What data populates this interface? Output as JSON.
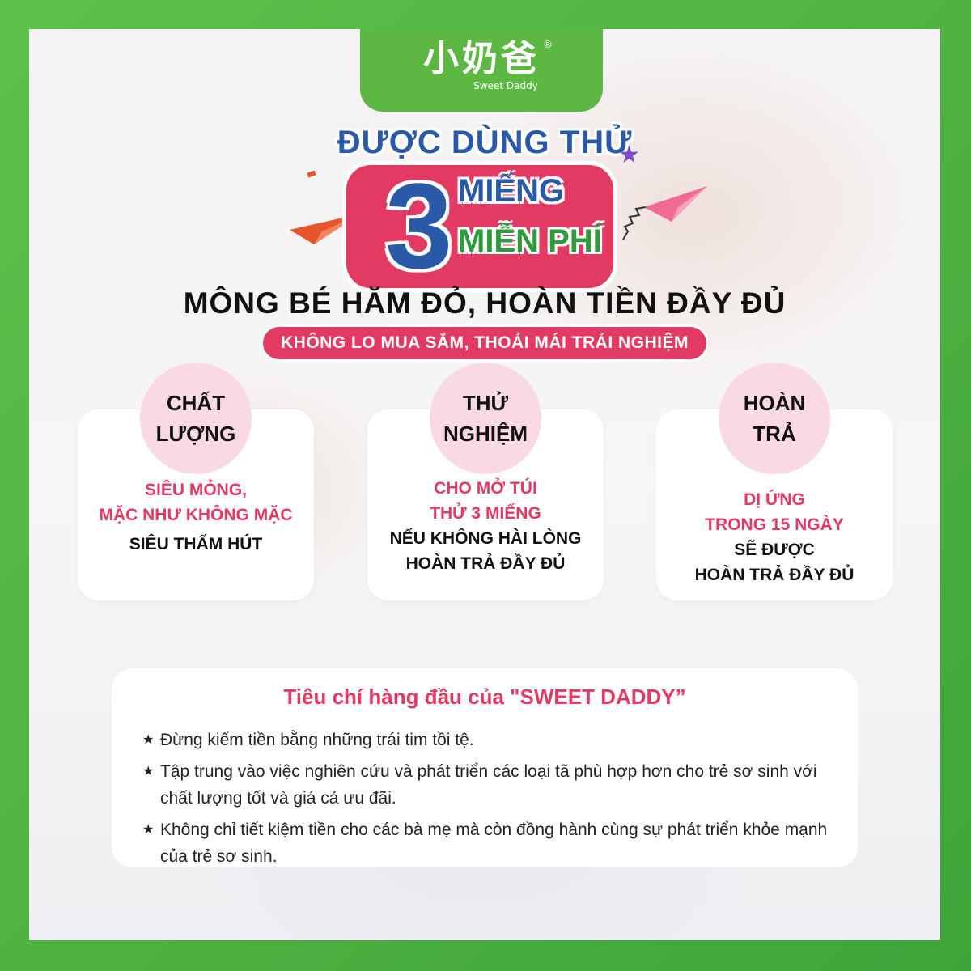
{
  "logo": {
    "main": "小奶爸",
    "sub": "Sweet Daddy",
    "reg": "®"
  },
  "headline": {
    "top": "ĐƯỢC DÙNG THỬ",
    "number": "3",
    "line1": "MIẾNG",
    "line2": "MIỄN PHÍ"
  },
  "subheadline": "MÔNG BÉ HĂM ĐỎ, HOÀN TIỀN ĐẦY ĐỦ",
  "pill": "KHÔNG LO MUA SẮM, THOẢI MÁI TRẢI NGHIỆM",
  "cards": [
    {
      "title_l1": "CHẤT",
      "title_l2": "LƯỢNG",
      "pink_l1": "SIÊU MỎNG,",
      "pink_l2": "MẶC NHƯ KHÔNG MẶC",
      "dark_l1": "SIÊU THẤM HÚT",
      "dark_l2": ""
    },
    {
      "title_l1": "THỬ",
      "title_l2": "NGHIỆM",
      "pink_l1": "CHO MỞ TÚI",
      "pink_l2": "THỬ 3 MIẾNG",
      "dark_l1": "NẾU KHÔNG HÀI LÒNG",
      "dark_l2": "HOÀN TRẢ ĐẦY ĐỦ"
    },
    {
      "title_l1": "HOÀN",
      "title_l2": "TRẢ",
      "pink_l1": "DỊ ỨNG",
      "pink_l2": "TRONG 15 NGÀY",
      "dark_l1": "SẼ ĐƯỢC",
      "dark_l2": "HOÀN TRẢ ĐẦY ĐỦ"
    }
  ],
  "criteria": {
    "title": "Tiêu chí hàng đầu của \"SWEET DADDY”",
    "bullet_symbol": "★",
    "items": [
      "Đừng kiếm tiền bằng những trái tim tồi tệ.",
      "Tập trung vào việc nghiên cứu và phát triển các loại tã phù hợp hơn cho trẻ sơ sinh với chất lượng tốt và giá cả ưu đãi.",
      "Không chỉ tiết kiệm tiền cho các bà mẹ mà còn đồng hành cùng sự phát triển khỏe mạnh của trẻ sơ sinh."
    ]
  },
  "colors": {
    "green": "#5cb843",
    "pink": "#e33a64",
    "blue": "#2a5aa7",
    "circle_pink": "#f9d9e4"
  }
}
